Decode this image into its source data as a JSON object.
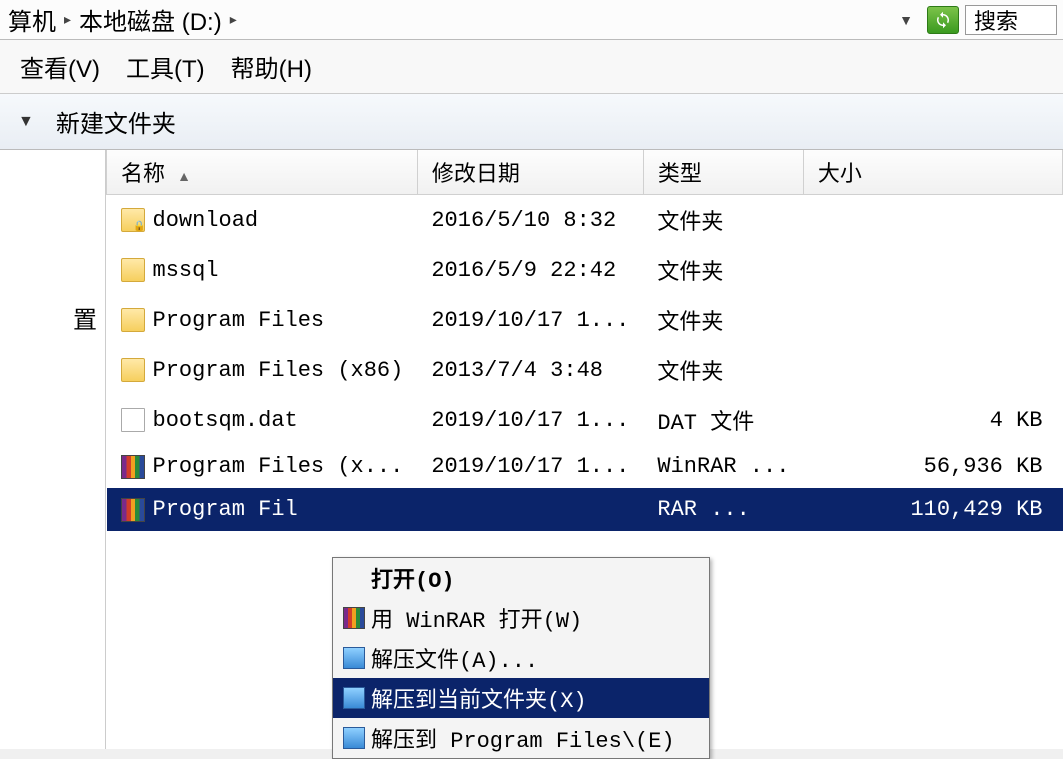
{
  "breadcrumb": {
    "part1": "算机",
    "part2": "本地磁盘 (D:)"
  },
  "search_label": "搜索",
  "menu": {
    "view": "查看(V)",
    "tools": "工具(T)",
    "help": "帮助(H)"
  },
  "toolbar": {
    "new_folder": "新建文件夹"
  },
  "sidebar": {
    "item": "置"
  },
  "columns": {
    "name": "名称",
    "date": "修改日期",
    "type": "类型",
    "size": "大小"
  },
  "files": [
    {
      "name": "download",
      "date": "2016/5/10 8:32",
      "type": "文件夹",
      "size": "",
      "icon": "folder-locked"
    },
    {
      "name": "mssql",
      "date": "2016/5/9 22:42",
      "type": "文件夹",
      "size": "",
      "icon": "folder"
    },
    {
      "name": "Program Files",
      "date": "2019/10/17 1...",
      "type": "文件夹",
      "size": "",
      "icon": "folder"
    },
    {
      "name": "Program Files (x86)",
      "date": "2013/7/4 3:48",
      "type": "文件夹",
      "size": "",
      "icon": "folder"
    },
    {
      "name": "bootsqm.dat",
      "date": "2019/10/17 1...",
      "type": "DAT 文件",
      "size": "4 KB",
      "icon": "file"
    },
    {
      "name": "Program Files (x...",
      "date": "2019/10/17 1...",
      "type": "WinRAR ...",
      "size": "56,936 KB",
      "icon": "rar"
    },
    {
      "name": "Program Fil",
      "date": "",
      "type": "  RAR ...",
      "size": "110,429 KB",
      "icon": "rar",
      "selected": true
    }
  ],
  "context_menu": [
    {
      "label": "打开(O)",
      "icon": "blank",
      "bold": true
    },
    {
      "label": "用 WinRAR 打开(W)",
      "icon": "rar"
    },
    {
      "label": "解压文件(A)...",
      "icon": "extract"
    },
    {
      "label": "解压到当前文件夹(X)",
      "icon": "extract",
      "highlight": true
    },
    {
      "label": "解压到 Program Files\\(E)",
      "icon": "extract"
    }
  ]
}
